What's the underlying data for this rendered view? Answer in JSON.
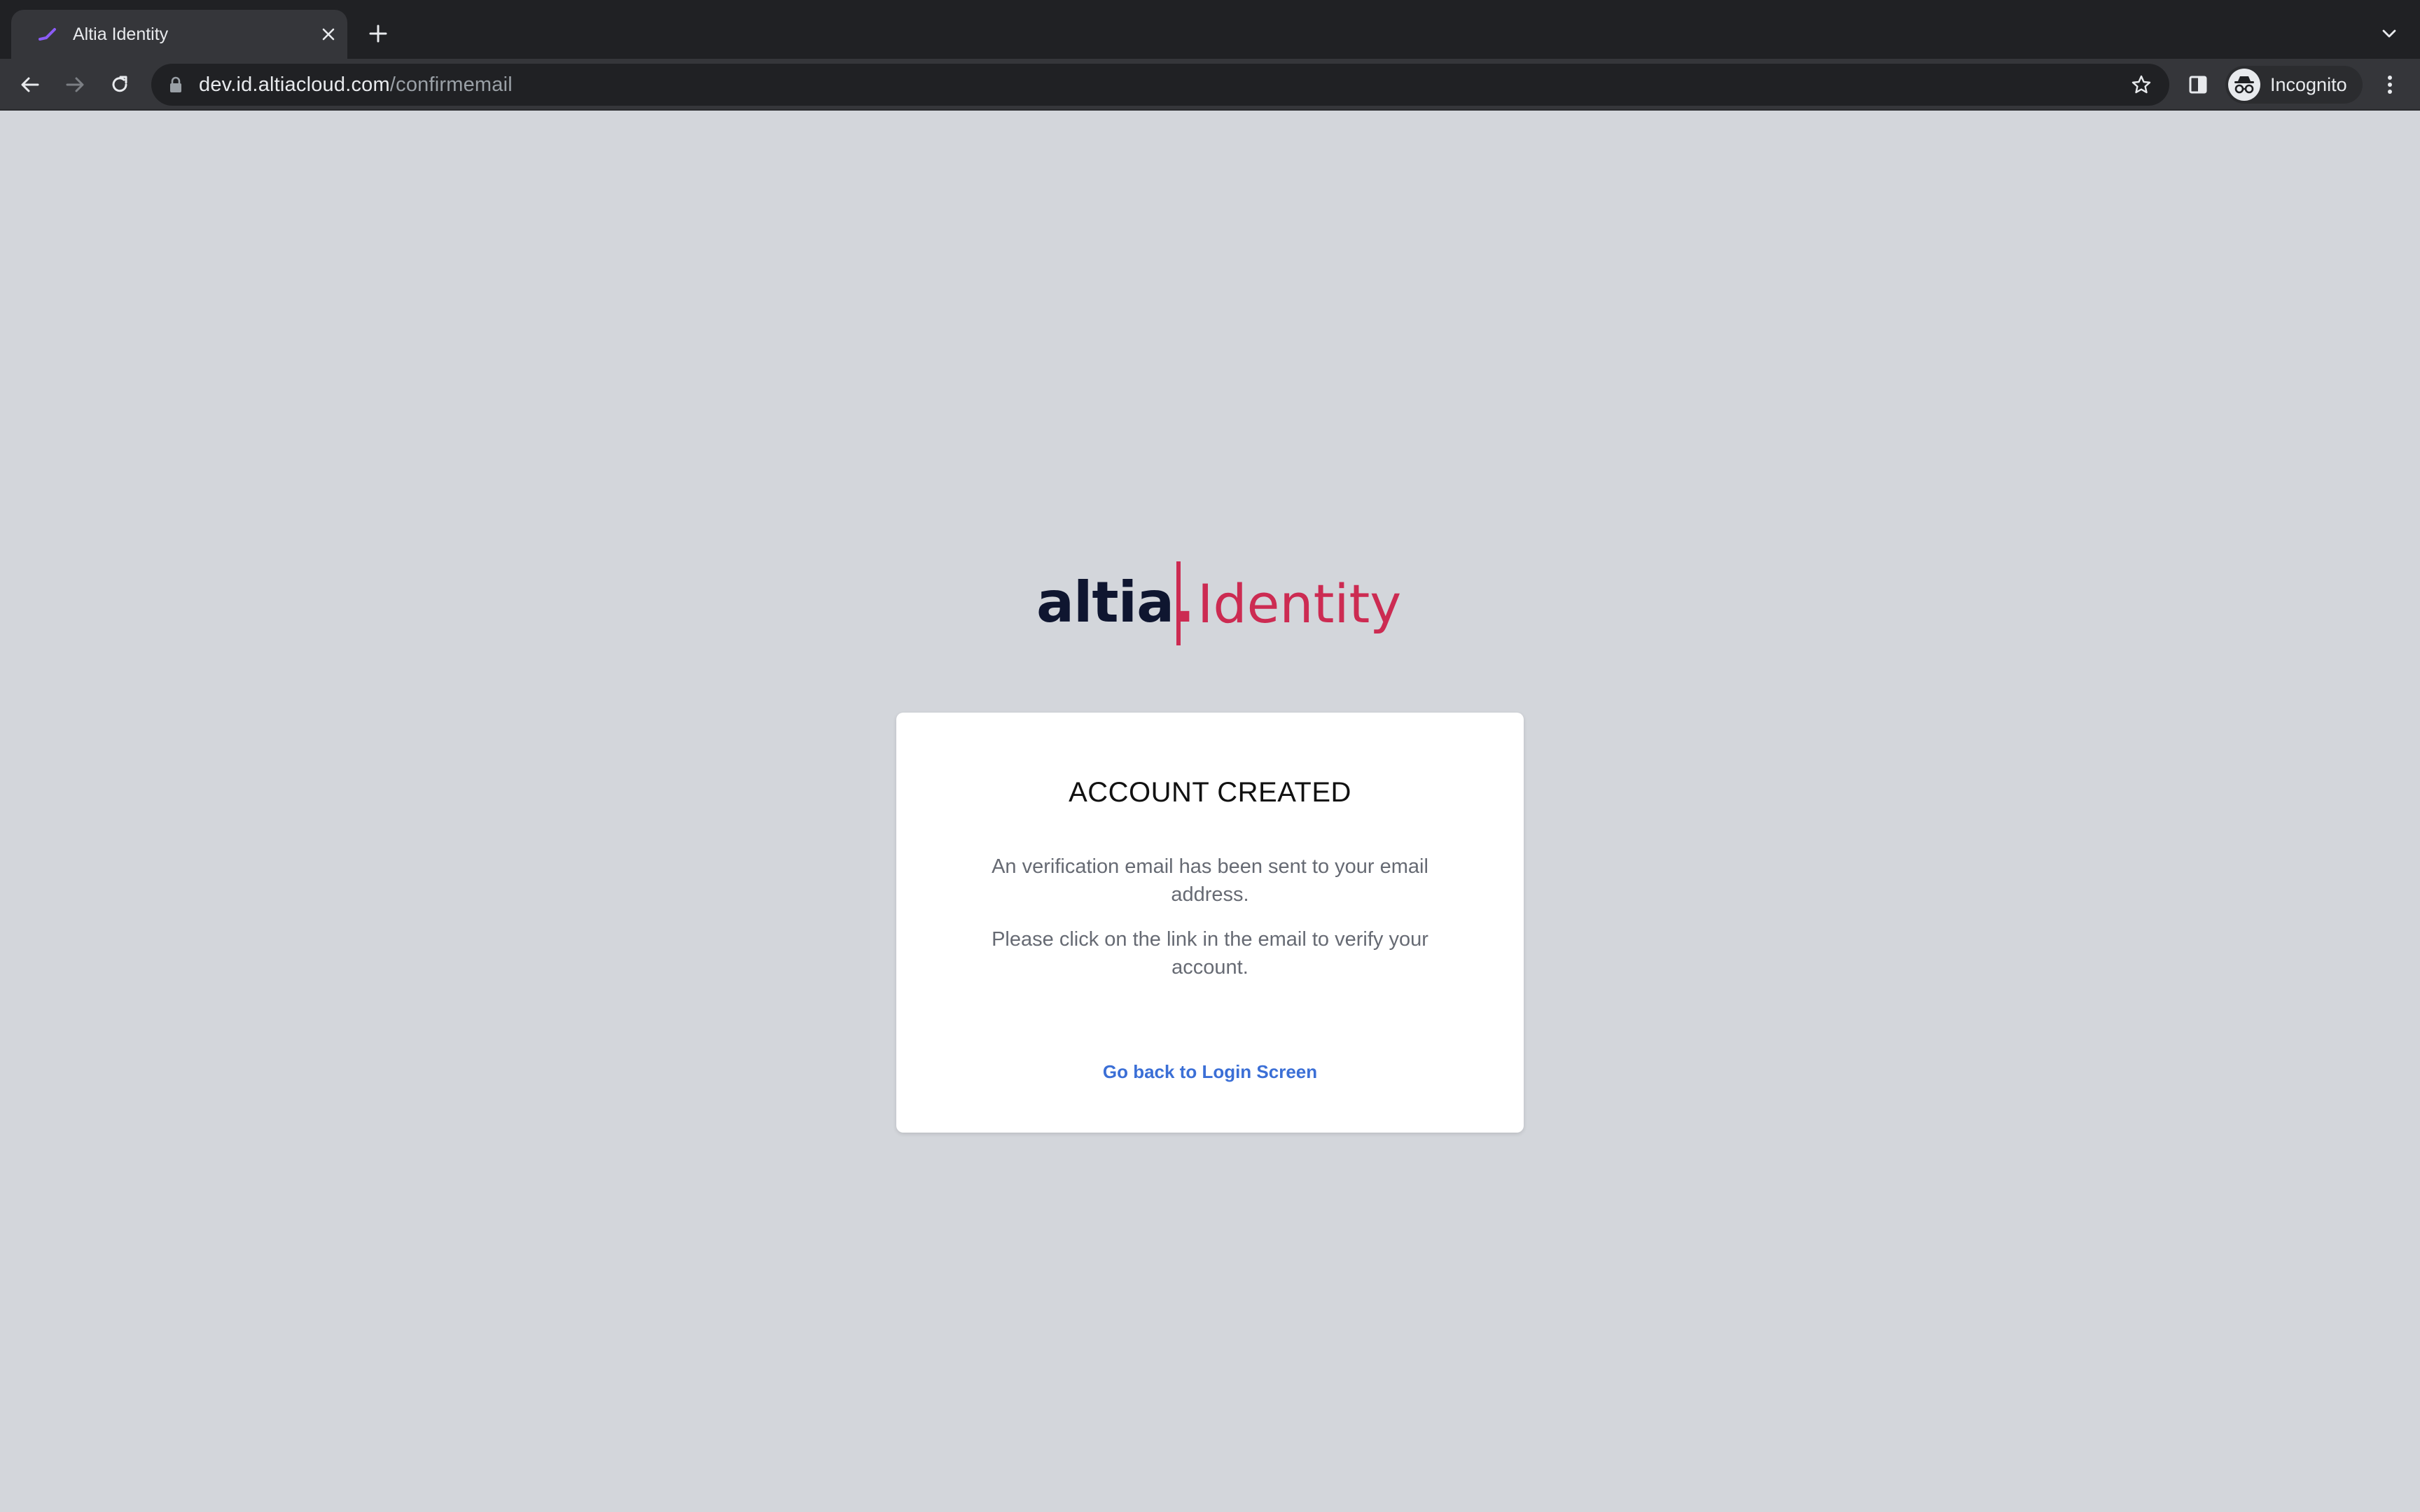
{
  "browser": {
    "tab_title": "Altia Identity",
    "url_host": "dev.id.altiacloud.com",
    "url_path": "/confirmemail",
    "profile_label": "Incognito"
  },
  "logo": {
    "brand": "altia",
    "brand_dot": ".",
    "product": "Identity"
  },
  "card": {
    "title": "ACCOUNT CREATED",
    "message_1": "An verification email has been sent to your email address.",
    "message_2": "Please click on the link in the email to verify your account.",
    "link_label": "Go back to Login Screen"
  },
  "colors": {
    "page_background": "#d3d6db",
    "brand_navy": "#0f1630",
    "brand_accent": "#cc2b52",
    "link": "#3b6fd6"
  },
  "icons": {
    "favicon": "altia-favicon-icon",
    "tab_close": "close-icon",
    "new_tab": "plus-icon",
    "tab_search": "chevron-down-icon",
    "back": "arrow-left-icon",
    "forward": "arrow-right-icon",
    "reload": "reload-icon",
    "lock": "lock-icon",
    "bookmark": "star-icon",
    "side_panel": "side-panel-icon",
    "incognito": "incognito-icon",
    "menu": "kebab-menu-icon"
  }
}
